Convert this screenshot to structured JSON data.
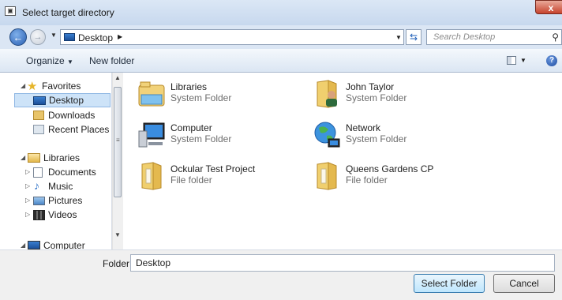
{
  "window": {
    "title": "Select target directory",
    "close_label": "x"
  },
  "address": {
    "location": "Desktop",
    "search_placeholder": "Search Desktop"
  },
  "toolbar": {
    "organize_label": "Organize",
    "new_folder_label": "New folder"
  },
  "nav": {
    "favorites": "Favorites",
    "desktop": "Desktop",
    "downloads": "Downloads",
    "recent": "Recent Places",
    "libraries": "Libraries",
    "documents": "Documents",
    "music": "Music",
    "pictures": "Pictures",
    "videos": "Videos",
    "computer": "Computer"
  },
  "items": [
    {
      "name": "Libraries",
      "type": "System Folder",
      "icon": "libraries-icon"
    },
    {
      "name": "John Taylor",
      "type": "System Folder",
      "icon": "user-folder-icon"
    },
    {
      "name": "Computer",
      "type": "System Folder",
      "icon": "computer-icon"
    },
    {
      "name": "Network",
      "type": "System Folder",
      "icon": "network-icon"
    },
    {
      "name": "Ockular Test Project",
      "type": "File folder",
      "icon": "folder-icon"
    },
    {
      "name": "Queens Gardens CP",
      "type": "File folder",
      "icon": "folder-icon"
    }
  ],
  "footer": {
    "folder_label": "Folder:",
    "folder_value": "Desktop",
    "select_label": "Select Folder",
    "cancel_label": "Cancel"
  }
}
